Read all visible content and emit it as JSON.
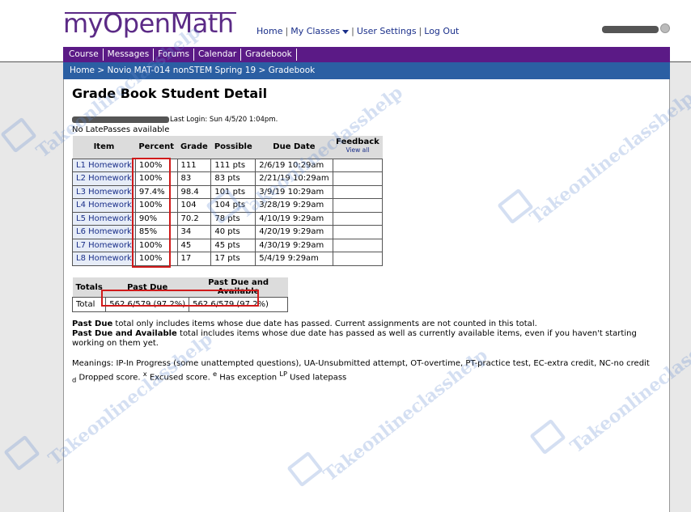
{
  "header": {
    "logo": "myOpenMath",
    "links": {
      "home": "Home",
      "my_classes": "My Classes",
      "user_settings": "User Settings",
      "log_out": "Log Out"
    }
  },
  "nav": {
    "tabs": [
      "Course",
      "Messages",
      "Forums",
      "Calendar",
      "Gradebook"
    ]
  },
  "breadcrumb": "Home > Novio MAT-014 nonSTEM Spring 19 > Gradebook",
  "page_title": "Grade Book Student Detail",
  "last_login": "Last Login: Sun 4/5/20 1:04pm.",
  "latepass": "No LatePasses available",
  "grades_table": {
    "headers": [
      "Item",
      "Percent",
      "Grade",
      "Possible",
      "Due Date",
      "Feedback"
    ],
    "view_all": "View all",
    "rows": [
      {
        "item": "L1 Homework",
        "percent": "100%",
        "grade": "111",
        "possible": "111 pts",
        "due": "2/6/19 10:29am"
      },
      {
        "item": "L2 Homework",
        "percent": "100%",
        "grade": "83",
        "possible": "83 pts",
        "due": "2/21/19 10:29am"
      },
      {
        "item": "L3 Homework",
        "percent": "97.4%",
        "grade": "98.4",
        "possible": "101 pts",
        "due": "3/9/19 10:29am"
      },
      {
        "item": "L4 Homework",
        "percent": "100%",
        "grade": "104",
        "possible": "104 pts",
        "due": "3/28/19 9:29am"
      },
      {
        "item": "L5 Homework",
        "percent": "90%",
        "grade": "70.2",
        "possible": "78 pts",
        "due": "4/10/19 9:29am"
      },
      {
        "item": "L6 Homework",
        "percent": "85%",
        "grade": "34",
        "possible": "40 pts",
        "due": "4/20/19 9:29am"
      },
      {
        "item": "L7 Homework",
        "percent": "100%",
        "grade": "45",
        "possible": "45 pts",
        "due": "4/30/19 9:29am"
      },
      {
        "item": "L8 Homework",
        "percent": "100%",
        "grade": "17",
        "possible": "17 pts",
        "due": "5/4/19 9:29am"
      }
    ]
  },
  "totals_table": {
    "headers": [
      "Totals",
      "Past Due",
      "Past Due and Available"
    ],
    "row_label": "Total",
    "past_due": "562.6/579 (97.2%)",
    "past_due_available": "562.6/579 (97.2%)"
  },
  "notes": {
    "past_due_label": "Past Due",
    "past_due_text": " total only includes items whose due date has passed. Current assignments are not counted in this total.",
    "pda_label": "Past Due and Available",
    "pda_text": " total includes items whose due date has passed as well as currently available items, even if you haven't starting working on them yet.",
    "meanings": "Meanings: IP-In Progress (some unattempted questions), UA-Unsubmitted attempt, OT-overtime, PT-practice test, EC-extra credit, NC-no credit",
    "meanings2_d": "d",
    "meanings2_a": " Dropped score.",
    "meanings2_x": "x",
    "meanings2_b": " Excused score.",
    "meanings2_e": "e",
    "meanings2_c": " Has exception ",
    "meanings2_lp": "LP",
    "meanings2_tail": " Used latepass"
  },
  "watermark": "Takeonlineclasshelp",
  "colors": {
    "brand_purple": "#5b1a86",
    "breadcrumb_blue": "#2b5fa3",
    "highlight_red": "#d01a1a"
  }
}
